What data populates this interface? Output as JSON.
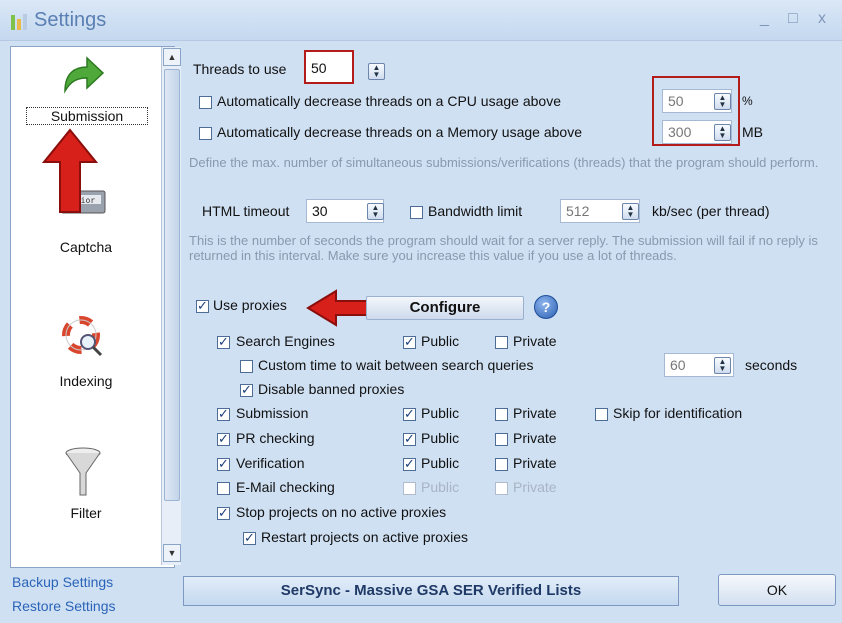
{
  "window": {
    "title": "Settings",
    "minimize": "_",
    "maximize": "□",
    "close": "x"
  },
  "nav": {
    "items": [
      {
        "label": "Submission",
        "icon": "green-arrow-icon"
      },
      {
        "label": "Captcha",
        "icon": "captcha-keyboard-icon"
      },
      {
        "label": "Indexing",
        "icon": "lifebuoy-magnifier-icon"
      },
      {
        "label": "Filter",
        "icon": "funnel-icon"
      }
    ]
  },
  "links": {
    "backup": "Backup Settings",
    "restore": "Restore Settings"
  },
  "threads": {
    "label": "Threads to use",
    "value": "50",
    "cpu_label": "Automatically decrease threads on a CPU usage above",
    "cpu_value": "50",
    "cpu_unit": "%",
    "mem_label": "Automatically decrease threads on a Memory usage above",
    "mem_value": "300",
    "mem_unit": "MB",
    "help": "Define the max. number of simultaneous submissions/verifications (threads) that the program should perform."
  },
  "timeout": {
    "label": "HTML timeout",
    "value": "30",
    "bandwidth_label": "Bandwidth limit",
    "bandwidth_value": "512",
    "bandwidth_unit": "kb/sec (per thread)",
    "help": "This is the number of seconds the program should wait for a server reply. The submission will fail if no reply is returned in this interval. Make sure you increase this value if you use a lot of threads."
  },
  "proxies": {
    "use_label": "Use proxies",
    "configure_label": "Configure",
    "help_icon": "?",
    "search_engines": "Search Engines",
    "public": "Public",
    "private": "Private",
    "custom_wait_label": "Custom time to wait between search queries",
    "custom_wait_value": "60",
    "custom_wait_unit": "seconds",
    "disable_banned": "Disable banned proxies",
    "submission": "Submission",
    "skip_identification": "Skip for identification",
    "pr_checking": "PR checking",
    "verification": "Verification",
    "email_checking": "E-Mail checking",
    "stop_projects": "Stop projects on no active proxies",
    "restart_projects": "Restart projects on active proxies"
  },
  "footer": {
    "banner": "SerSync - Massive GSA SER Verified Lists",
    "ok": "OK"
  },
  "colors": {
    "annotation_red": "#b41c1c",
    "accent_blue": "#2a63b8"
  }
}
